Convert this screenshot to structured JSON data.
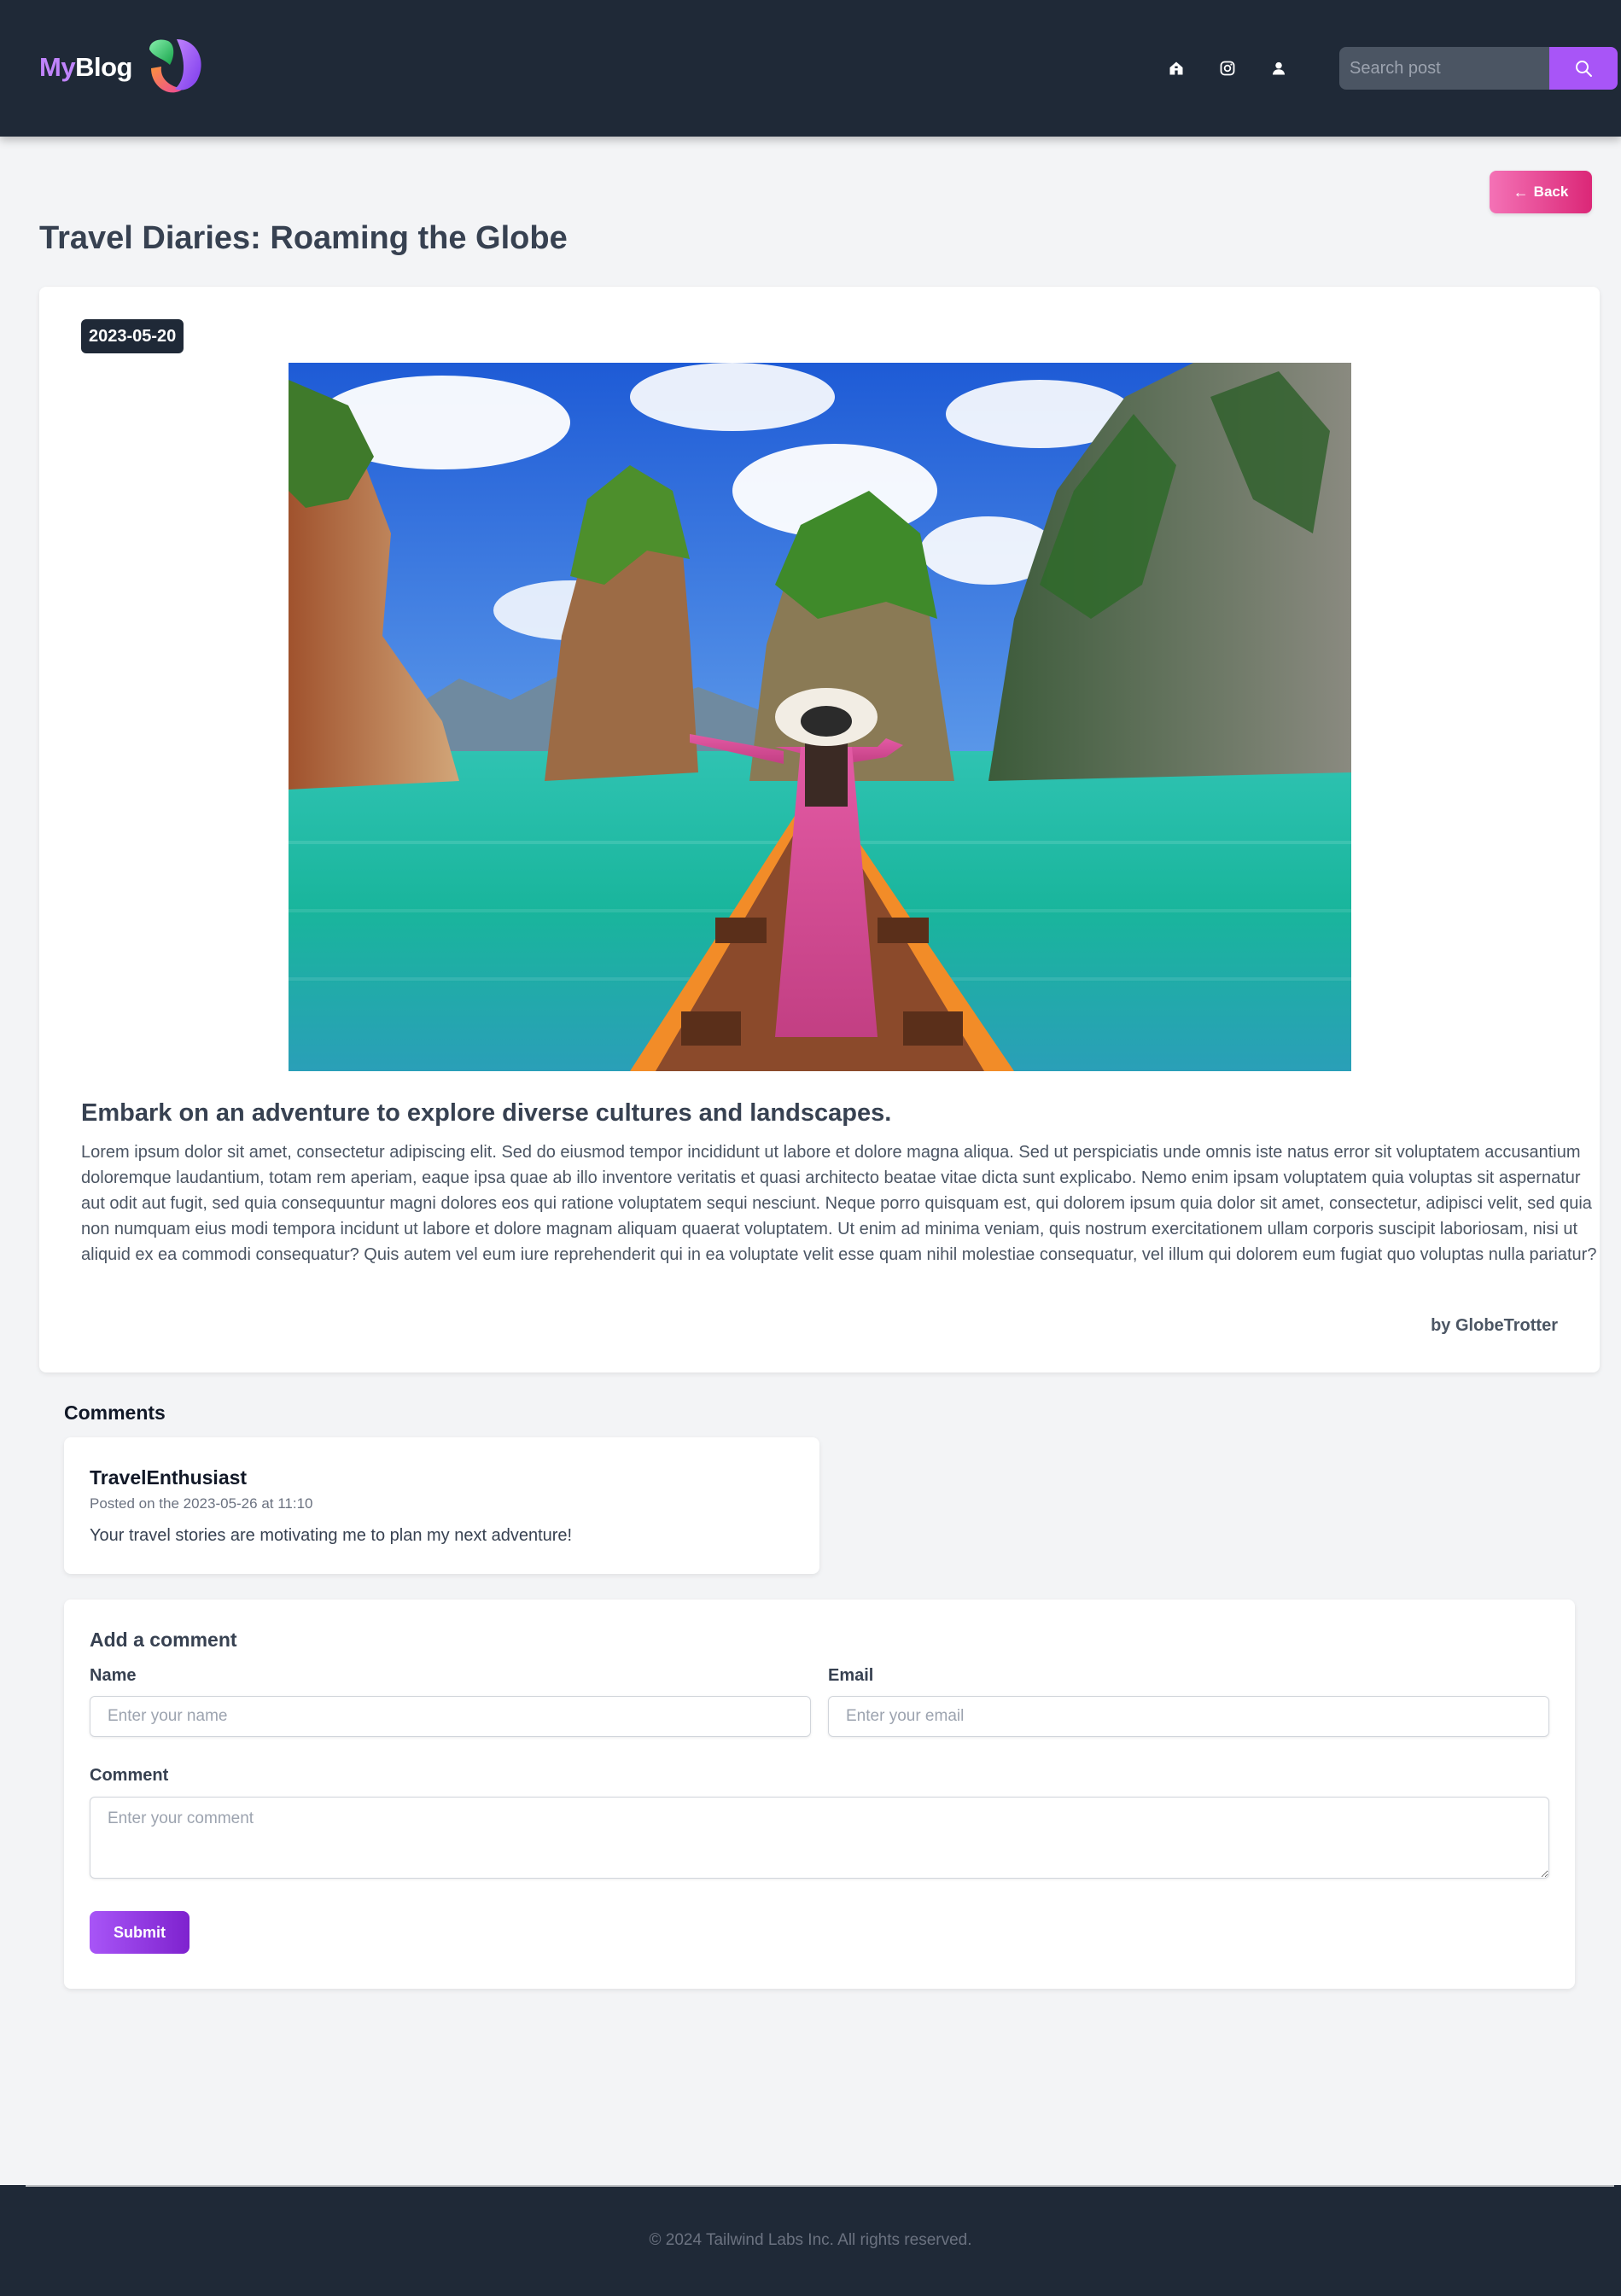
{
  "header": {
    "brand_my": "My",
    "brand_blog": "Blog",
    "icons": [
      "home-icon",
      "instagram-icon",
      "user-icon"
    ],
    "search": {
      "placeholder": "Search post",
      "value": ""
    }
  },
  "post": {
    "back_label": "Back",
    "title": "Travel Diaries: Roaming the Globe",
    "date": "2023-05-20",
    "subtitle": "Embark on an adventure to explore diverse cultures and landscapes.",
    "body": "Lorem ipsum dolor sit amet, consectetur adipiscing elit. Sed do eiusmod tempor incididunt ut labore et dolore magna aliqua. Sed ut perspiciatis unde omnis iste natus error sit voluptatem accusantium doloremque laudantium, totam rem aperiam, eaque ipsa quae ab illo inventore veritatis et quasi architecto beatae vitae dicta sunt explicabo. Nemo enim ipsam voluptatem quia voluptas sit aspernatur aut odit aut fugit, sed quia consequuntur magni dolores eos qui ratione voluptatem sequi nesciunt. Neque porro quisquam est, qui dolorem ipsum quia dolor sit amet, consectetur, adipisci velit, sed quia non numquam eius modi tempora incidunt ut labore et dolore magnam aliquam quaerat voluptatem. Ut enim ad minima veniam, quis nostrum exercitationem ullam corporis suscipit laboriosam, nisi ut aliquid ex ea commodi consequatur? Quis autem vel eum iure reprehenderit qui in ea voluptate velit esse quam nihil molestiae consequatur, vel illum qui dolorem eum fugiat quo voluptas nulla pariatur?",
    "author": "by GlobeTrotter"
  },
  "comments": {
    "heading": "Comments",
    "items": [
      {
        "author": "TravelEnthusiast",
        "meta": "Posted on the 2023-05-26 at 11:10",
        "text": "Your travel stories are motivating me to plan my next adventure!"
      }
    ]
  },
  "form": {
    "title": "Add a comment",
    "name_label": "Name",
    "name_placeholder": "Enter your name",
    "email_label": "Email",
    "email_placeholder": "Enter your email",
    "comment_label": "Comment",
    "comment_placeholder": "Enter your comment",
    "submit_label": "Submit"
  },
  "footer": {
    "text": "© 2024 Tailwind Labs Inc. All rights reserved."
  },
  "colors": {
    "nav_bg": "#1f2937",
    "page_bg": "#f3f4f6",
    "accent_purple": "#a855f7",
    "accent_pink": "#db2777"
  }
}
